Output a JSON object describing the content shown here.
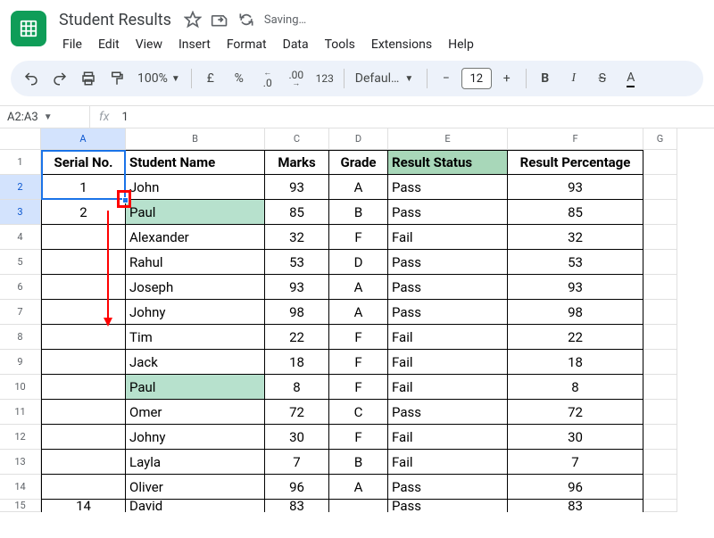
{
  "header": {
    "doc_title": "Student Results",
    "saving_label": "Saving…",
    "menu": [
      "File",
      "Edit",
      "View",
      "Insert",
      "Format",
      "Data",
      "Tools",
      "Extensions",
      "Help"
    ]
  },
  "toolbar": {
    "zoom": "100%",
    "currency_symbol": "£",
    "percent_symbol": "%",
    "dec_dec": ".0",
    "inc_dec": ".00",
    "num123": "123",
    "font_name": "Defaul…",
    "font_size": "12",
    "minus": "−",
    "plus": "+",
    "text_A": "A"
  },
  "formula": {
    "name_box": "A2:A3",
    "fx_label": "fx",
    "value": "1"
  },
  "col_headers": [
    "A",
    "B",
    "C",
    "D",
    "E",
    "F",
    "G"
  ],
  "row_headers": [
    "1",
    "2",
    "3",
    "4",
    "5",
    "6",
    "7",
    "8",
    "9",
    "10",
    "11",
    "12",
    "13",
    "14",
    "15"
  ],
  "table_header": {
    "serial": "Serial No.",
    "name": "Student  Name",
    "marks": "Marks",
    "grade": "Grade",
    "status": "Result Status",
    "percent": "Result Percentage"
  },
  "rows": [
    {
      "serial": "1",
      "name": "John",
      "marks": "93",
      "grade": "A",
      "status": "Pass",
      "percent": "93",
      "green": false
    },
    {
      "serial": "2",
      "name": "Paul",
      "marks": "85",
      "grade": "B",
      "status": "Pass",
      "percent": "85",
      "green": true
    },
    {
      "serial": "",
      "name": "Alexander",
      "marks": "32",
      "grade": "F",
      "status": "Fail",
      "percent": "32",
      "green": false
    },
    {
      "serial": "",
      "name": "Rahul",
      "marks": "53",
      "grade": "D",
      "status": "Pass",
      "percent": "53",
      "green": false
    },
    {
      "serial": "",
      "name": "Joseph",
      "marks": "93",
      "grade": "A",
      "status": "Pass",
      "percent": "93",
      "green": false
    },
    {
      "serial": "",
      "name": "Johny",
      "marks": "98",
      "grade": "A",
      "status": "Pass",
      "percent": "98",
      "green": false
    },
    {
      "serial": "",
      "name": "Tim",
      "marks": "22",
      "grade": "F",
      "status": "Fail",
      "percent": "22",
      "green": false
    },
    {
      "serial": "",
      "name": "Jack",
      "marks": "18",
      "grade": "F",
      "status": "Fail",
      "percent": "18",
      "green": false
    },
    {
      "serial": "",
      "name": "Paul",
      "marks": "8",
      "grade": "F",
      "status": "Fail",
      "percent": "8",
      "green": true
    },
    {
      "serial": "",
      "name": "Omer",
      "marks": "72",
      "grade": "C",
      "status": "Pass",
      "percent": "72",
      "green": false
    },
    {
      "serial": "",
      "name": "Johny",
      "marks": "30",
      "grade": "F",
      "status": "Fail",
      "percent": "30",
      "green": false
    },
    {
      "serial": "",
      "name": "Layla",
      "marks": "7",
      "grade": "B",
      "status": "Fail",
      "percent": "7",
      "green": false
    },
    {
      "serial": "",
      "name": "Oliver",
      "marks": "96",
      "grade": "A",
      "status": "Pass",
      "percent": "96",
      "green": false
    }
  ],
  "cut_row": {
    "serial": "14",
    "name": "David",
    "marks": "83",
    "grade": "",
    "status": "Pass",
    "percent": "83"
  }
}
